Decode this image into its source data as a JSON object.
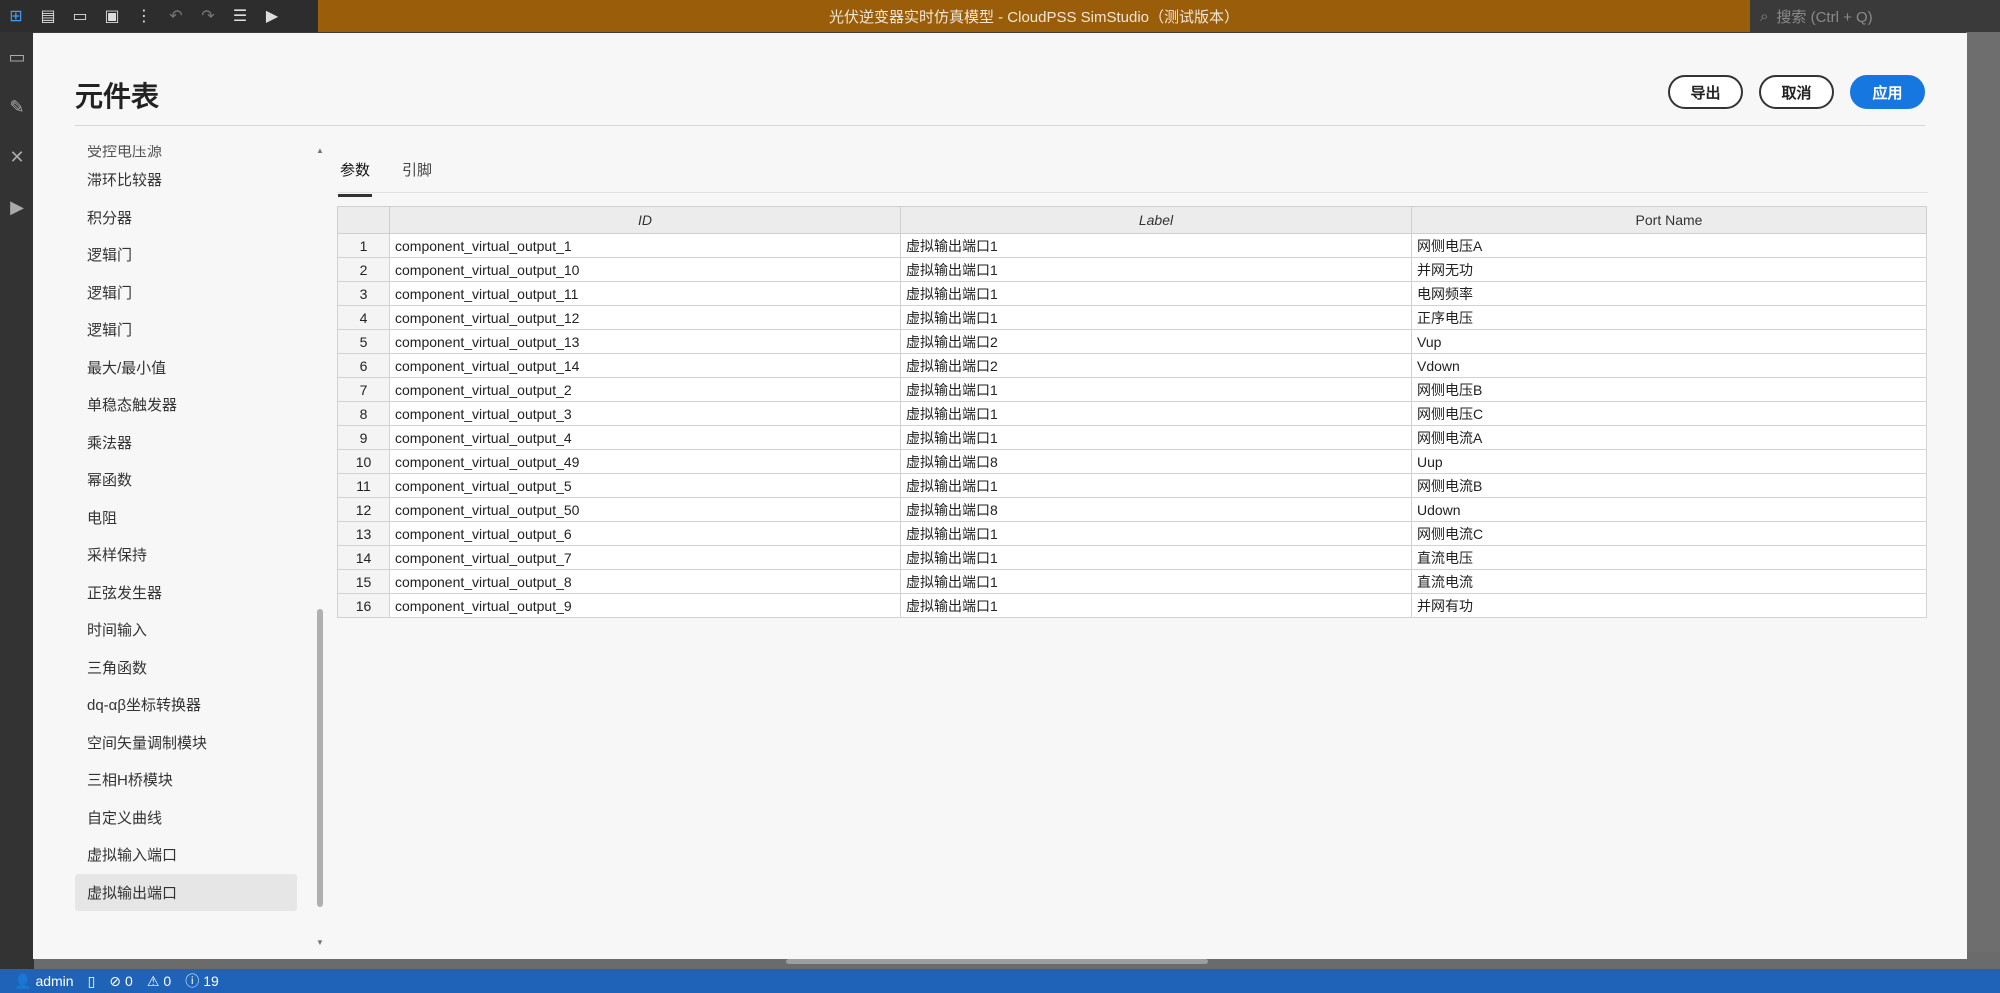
{
  "app": {
    "window_title": "光伏逆变器实时仿真模型 - CloudPSS SimStudio（测试版本）",
    "search_placeholder": "搜索 (Ctrl + Q)"
  },
  "status": {
    "user": "admin",
    "errors": "0",
    "warnings": "0",
    "infos": "19"
  },
  "dialog": {
    "title": "元件表",
    "export_label": "导出",
    "cancel_label": "取消",
    "apply_label": "应用",
    "tabs": [
      {
        "label": "参数",
        "active": true
      },
      {
        "label": "引脚",
        "active": false
      }
    ],
    "sidebar": {
      "partial_item": "受控电压源",
      "items": [
        {
          "label": "滞环比较器"
        },
        {
          "label": "积分器"
        },
        {
          "label": "逻辑门"
        },
        {
          "label": "逻辑门"
        },
        {
          "label": "逻辑门"
        },
        {
          "label": "最大/最小值"
        },
        {
          "label": "单稳态触发器"
        },
        {
          "label": "乘法器"
        },
        {
          "label": "幂函数"
        },
        {
          "label": "电阻"
        },
        {
          "label": "采样保持"
        },
        {
          "label": "正弦发生器"
        },
        {
          "label": "时间输入"
        },
        {
          "label": "三角函数"
        },
        {
          "label": "dq-αβ坐标转换器"
        },
        {
          "label": "空间矢量调制模块"
        },
        {
          "label": "三相H桥模块"
        },
        {
          "label": "自定义曲线"
        },
        {
          "label": "虚拟输入端口"
        },
        {
          "label": "虚拟输出端口",
          "selected": true
        }
      ]
    },
    "table": {
      "headers": {
        "index": "",
        "id": "ID",
        "label": "Label",
        "port": "Port Name"
      },
      "rows": [
        {
          "n": "1",
          "id": "component_virtual_output_1",
          "label": "虚拟输出端口1",
          "port": "网侧电压A"
        },
        {
          "n": "2",
          "id": "component_virtual_output_10",
          "label": "虚拟输出端口1",
          "port": "并网无功"
        },
        {
          "n": "3",
          "id": "component_virtual_output_11",
          "label": "虚拟输出端口1",
          "port": "电网频率"
        },
        {
          "n": "4",
          "id": "component_virtual_output_12",
          "label": "虚拟输出端口1",
          "port": "正序电压"
        },
        {
          "n": "5",
          "id": "component_virtual_output_13",
          "label": "虚拟输出端口2",
          "port": "Vup"
        },
        {
          "n": "6",
          "id": "component_virtual_output_14",
          "label": "虚拟输出端口2",
          "port": "Vdown"
        },
        {
          "n": "7",
          "id": "component_virtual_output_2",
          "label": "虚拟输出端口1",
          "port": "网侧电压B"
        },
        {
          "n": "8",
          "id": "component_virtual_output_3",
          "label": "虚拟输出端口1",
          "port": "网侧电压C"
        },
        {
          "n": "9",
          "id": "component_virtual_output_4",
          "label": "虚拟输出端口1",
          "port": "网侧电流A"
        },
        {
          "n": "10",
          "id": "component_virtual_output_49",
          "label": "虚拟输出端口8",
          "port": "Uup"
        },
        {
          "n": "11",
          "id": "component_virtual_output_5",
          "label": "虚拟输出端口1",
          "port": "网侧电流B"
        },
        {
          "n": "12",
          "id": "component_virtual_output_50",
          "label": "虚拟输出端口8",
          "port": "Udown"
        },
        {
          "n": "13",
          "id": "component_virtual_output_6",
          "label": "虚拟输出端口1",
          "port": "网侧电流C"
        },
        {
          "n": "14",
          "id": "component_virtual_output_7",
          "label": "虚拟输出端口1",
          "port": "直流电压"
        },
        {
          "n": "15",
          "id": "component_virtual_output_8",
          "label": "虚拟输出端口1",
          "port": "直流电流"
        },
        {
          "n": "16",
          "id": "component_virtual_output_9",
          "label": "虚拟输出端口1",
          "port": "并网有功"
        }
      ]
    }
  },
  "colors": {
    "title_bar": "#9a5e0b",
    "status_bar": "#1e63b8",
    "primary_button": "#1677e0"
  }
}
